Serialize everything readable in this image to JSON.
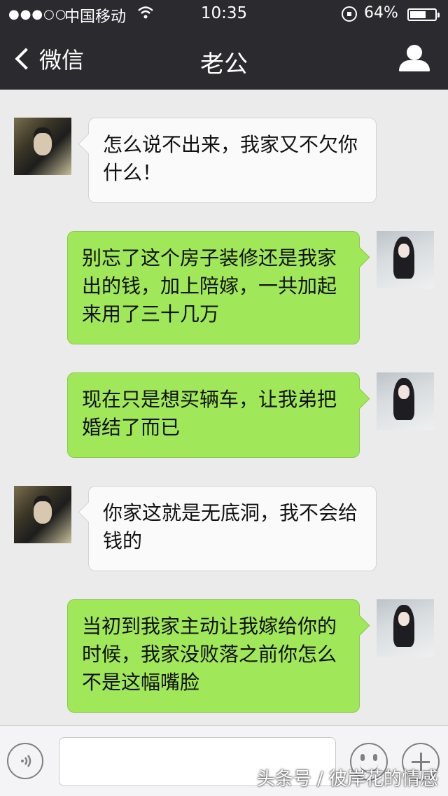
{
  "status_bar": {
    "signal": "●●●○○",
    "carrier": "中国移动",
    "time": "10:35",
    "battery_percent": "64%",
    "battery_level": 0.64
  },
  "nav": {
    "back_label": "微信",
    "title": "老公",
    "profile_icon": "person-icon"
  },
  "messages": [
    {
      "side": "left",
      "sender": "husband",
      "text": "怎么说不出来，我家又不欠你什么！"
    },
    {
      "side": "right",
      "sender": "me",
      "text": "别忘了这个房子装修还是我家出的钱，加上陪嫁，一共加起来用了三十几万"
    },
    {
      "side": "right",
      "sender": "me",
      "text": "现在只是想买辆车，让我弟把婚结了而已"
    },
    {
      "side": "left",
      "sender": "husband",
      "text": "你家这就是无底洞，我不会给钱的"
    },
    {
      "side": "right",
      "sender": "me",
      "text": "当初到我家主动让我嫁给你的时候，我家没败落之前你怎么不是这幅嘴脸"
    }
  ],
  "input_bar": {
    "voice_icon": "voice-icon",
    "emoji_icon": "emoji-icon",
    "plus_icon": "plus-icon"
  },
  "watermark": "头条号 / 彼岸花的情感",
  "colors": {
    "header_bg": "#2b2b2f",
    "chat_bg": "#ebebeb",
    "sent_bubble": "#a0e75a",
    "received_bubble": "#fafafa"
  }
}
